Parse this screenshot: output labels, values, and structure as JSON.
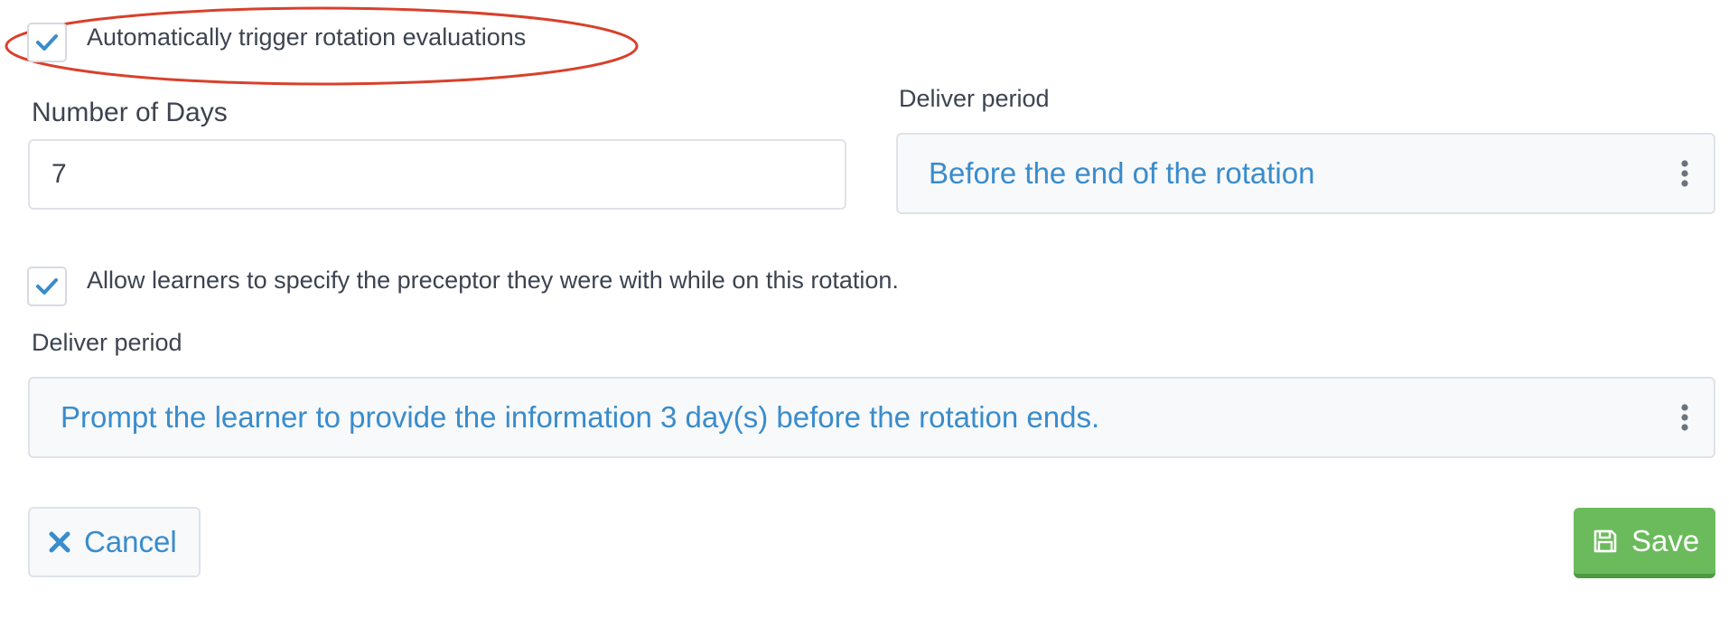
{
  "auto_trigger": {
    "label": "Automatically trigger rotation evaluations",
    "checked": true
  },
  "number_of_days": {
    "label": "Number of Days",
    "value": "7"
  },
  "deliver_period_rotation": {
    "label": "Deliver period",
    "value": "Before the end of the rotation"
  },
  "allow_preceptor": {
    "label": "Allow learners to specify the preceptor they were with while on this rotation.",
    "checked": true
  },
  "deliver_period_prompt": {
    "label": "Deliver period",
    "value": "Prompt the learner to provide the information 3 day(s) before the rotation ends."
  },
  "actions": {
    "cancel_label": "Cancel",
    "save_label": "Save"
  },
  "colors": {
    "accent_blue": "#3a8ccb",
    "save_green": "#6bbb5c",
    "annotation_red": "#d9402b"
  }
}
